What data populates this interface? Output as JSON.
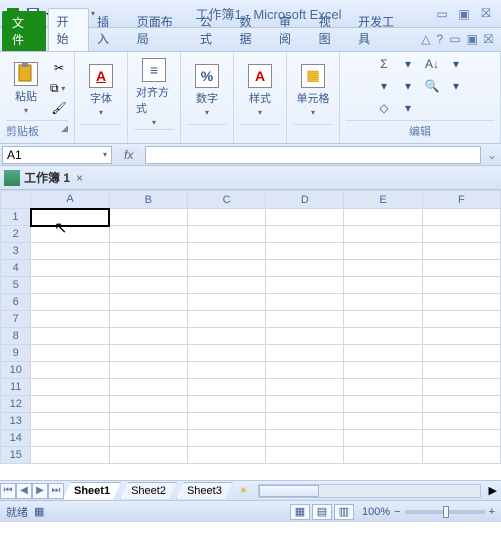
{
  "title": {
    "doc": "工作簿1",
    "app": "Microsoft Excel"
  },
  "tabs": {
    "file": "文件",
    "home": "开始",
    "insert": "插入",
    "layout": "页面布局",
    "formulas": "公式",
    "data": "数据",
    "review": "审阅",
    "view": "视图",
    "dev": "开发工具"
  },
  "ribbon": {
    "clipboard": {
      "paste": "粘贴",
      "label": "剪贴板"
    },
    "font": {
      "btn": "字体",
      "glyph": "A"
    },
    "align": {
      "btn": "对齐方式",
      "glyph": "≡"
    },
    "number": {
      "btn": "数字",
      "glyph": "%"
    },
    "styles": {
      "btn": "样式",
      "glyph": "A"
    },
    "cells": {
      "btn": "单元格",
      "glyph": "▦"
    },
    "editing": {
      "label": "编辑",
      "sum": "Σ",
      "fill": "▾",
      "clear": "◇",
      "sort": "A↓",
      "find": "🔍"
    }
  },
  "namebox": "A1",
  "fx": "fx",
  "workbook_window": "工作簿 1",
  "columns": [
    "A",
    "B",
    "C",
    "D",
    "E",
    "F"
  ],
  "rows": [
    "1",
    "2",
    "3",
    "4",
    "5",
    "6",
    "7",
    "8",
    "9",
    "10",
    "11",
    "12",
    "13",
    "14",
    "15"
  ],
  "sheets": {
    "s1": "Sheet1",
    "s2": "Sheet2",
    "s3": "Sheet3"
  },
  "status": {
    "ready": "就绪",
    "macro": "▦",
    "zoom": "100%"
  },
  "chart_data": null
}
